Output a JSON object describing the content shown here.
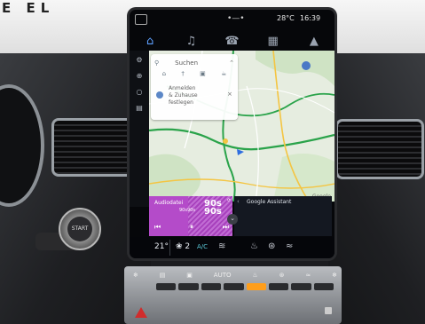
{
  "background": {
    "logo_text": "E  EL"
  },
  "status_bar": {
    "indicator": "•—•",
    "temperature": "28°C",
    "time": "16:39"
  },
  "nav_bar": {
    "items": [
      "⌂",
      "♫",
      "☎",
      "▦",
      "▲"
    ]
  },
  "map_side_icons": [
    "⚙",
    "⊕",
    "○",
    "▤"
  ],
  "search_card": {
    "search_placeholder": "Suchen",
    "categories": [
      "⌂",
      "†",
      "▣",
      "☕"
    ],
    "login_line1": "Anmelden",
    "login_line2": "& Zuhause",
    "login_line3": "festlegen",
    "close_glyph": "×"
  },
  "map": {
    "attribution": "Google"
  },
  "media": {
    "title": "Audiodatei",
    "subtitle": "90s90s",
    "big_line1": "90s",
    "big_line2": "90s",
    "controls": [
      "⏮",
      "⏸",
      "⏭"
    ],
    "corner_glyph": "⟳"
  },
  "assistant": {
    "label": "Google Assistant",
    "back_glyph": "‹"
  },
  "expand_glyph": "⌄",
  "climate": {
    "temperature": "21°",
    "fan_level": "❀ 2",
    "ac_label": "A/C",
    "icons": [
      "≋",
      "♨",
      "⊛",
      "≈"
    ]
  },
  "hardware_controls": {
    "labels": [
      "❄",
      "▤",
      "▣",
      "AUTO",
      "♨",
      "⊛",
      "≈",
      "❄"
    ]
  },
  "accent_color": "#b44bc9"
}
